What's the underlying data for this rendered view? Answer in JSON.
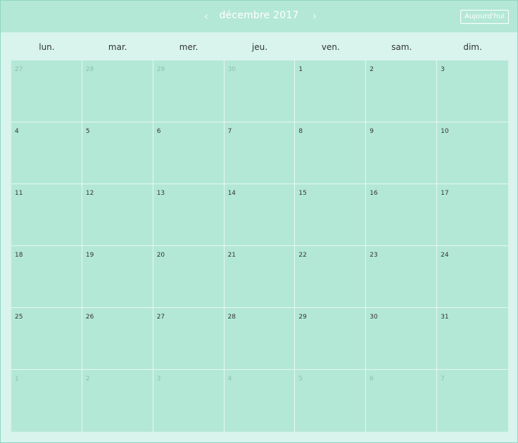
{
  "header": {
    "title": "décembre 2017",
    "prev_icon": "chevron-left-icon",
    "next_icon": "chevron-right-icon",
    "prev_glyph": "‹",
    "next_glyph": "›",
    "today_label": "Aujourd'hui"
  },
  "weekdays": [
    "lun.",
    "mar.",
    "mer.",
    "jeu.",
    "ven.",
    "sam.",
    "dim."
  ],
  "weeks": [
    [
      {
        "d": "27",
        "other": true
      },
      {
        "d": "28",
        "other": true
      },
      {
        "d": "29",
        "other": true
      },
      {
        "d": "30",
        "other": true
      },
      {
        "d": "1",
        "other": false
      },
      {
        "d": "2",
        "other": false
      },
      {
        "d": "3",
        "other": false
      }
    ],
    [
      {
        "d": "4",
        "other": false
      },
      {
        "d": "5",
        "other": false
      },
      {
        "d": "6",
        "other": false
      },
      {
        "d": "7",
        "other": false
      },
      {
        "d": "8",
        "other": false
      },
      {
        "d": "9",
        "other": false
      },
      {
        "d": "10",
        "other": false
      }
    ],
    [
      {
        "d": "11",
        "other": false
      },
      {
        "d": "12",
        "other": false
      },
      {
        "d": "13",
        "other": false
      },
      {
        "d": "14",
        "other": false
      },
      {
        "d": "15",
        "other": false
      },
      {
        "d": "16",
        "other": false
      },
      {
        "d": "17",
        "other": false
      }
    ],
    [
      {
        "d": "18",
        "other": false
      },
      {
        "d": "19",
        "other": false
      },
      {
        "d": "20",
        "other": false
      },
      {
        "d": "21",
        "other": false
      },
      {
        "d": "22",
        "other": false
      },
      {
        "d": "23",
        "other": false
      },
      {
        "d": "24",
        "other": false
      }
    ],
    [
      {
        "d": "25",
        "other": false
      },
      {
        "d": "26",
        "other": false
      },
      {
        "d": "27",
        "other": false
      },
      {
        "d": "28",
        "other": false
      },
      {
        "d": "29",
        "other": false
      },
      {
        "d": "30",
        "other": false
      },
      {
        "d": "31",
        "other": false
      }
    ],
    [
      {
        "d": "1",
        "other": true
      },
      {
        "d": "2",
        "other": true
      },
      {
        "d": "3",
        "other": true
      },
      {
        "d": "4",
        "other": true
      },
      {
        "d": "5",
        "other": true
      },
      {
        "d": "6",
        "other": true
      },
      {
        "d": "7",
        "other": true
      }
    ]
  ],
  "colors": {
    "header_bg": "#b4e8d6",
    "cell_bg": "#b4e8d6",
    "page_bg": "#d8f4ec",
    "text": "#333333",
    "other_month_text": "#8cbfae"
  }
}
